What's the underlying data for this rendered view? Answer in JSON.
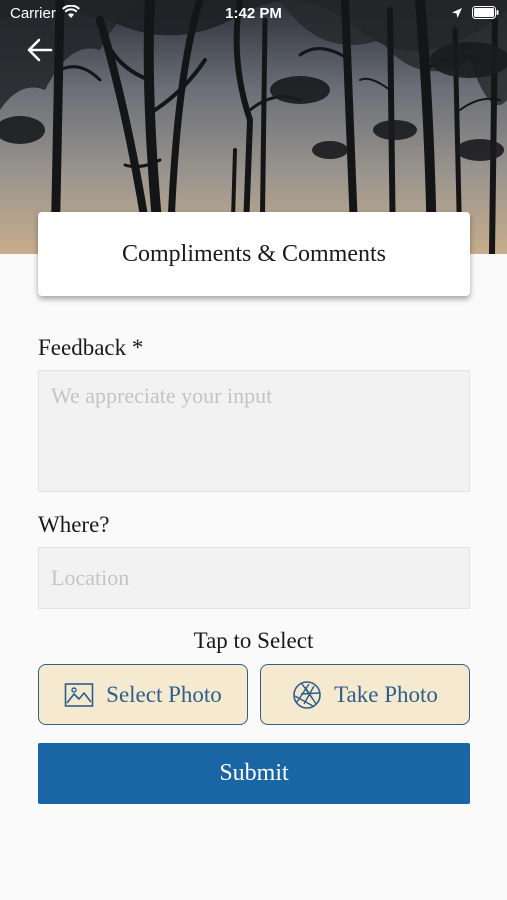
{
  "status_bar": {
    "carrier": "Carrier",
    "time": "1:42 PM"
  },
  "header": {
    "title": "Compliments & Comments"
  },
  "form": {
    "feedback_label": "Feedback *",
    "feedback_placeholder": "We appreciate your input",
    "feedback_value": "",
    "where_label": "Where?",
    "location_placeholder": "Location",
    "location_value": ""
  },
  "photo": {
    "prompt": "Tap to Select",
    "select_label": "Select Photo",
    "take_label": "Take Photo"
  },
  "submit_label": "Submit",
  "colors": {
    "accent": "#1a65a3",
    "button_fill": "#f5ead0",
    "button_border": "#2e5e8a",
    "field_bg": "#f2f2f2"
  },
  "icons": {
    "back": "arrow-left-icon",
    "select_photo": "image-icon",
    "take_photo": "aperture-icon"
  }
}
